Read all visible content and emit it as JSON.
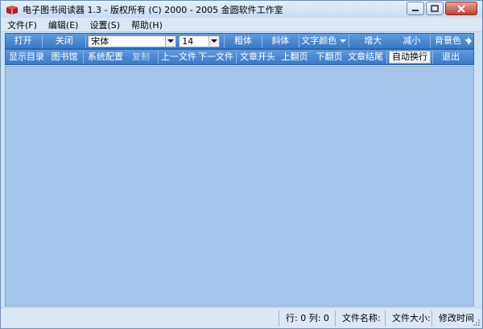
{
  "window": {
    "title": "电子图书阅读器 1.3  - 版权所有 (C) 2000 - 2005 金圆软件工作室"
  },
  "menu": [
    {
      "label": "文件(F)"
    },
    {
      "label": "编辑(E)"
    },
    {
      "label": "设置(S)"
    },
    {
      "label": "帮助(H)"
    }
  ],
  "toolbar1": {
    "open": "打开",
    "close": "关闭",
    "font_name": "宋体",
    "font_size": "14",
    "bold": "粗体",
    "italic": "斜体",
    "text_color": "文字颜色",
    "enlarge": "增大",
    "shrink": "减小",
    "bg_color": "背景色"
  },
  "toolbar2": {
    "show_toc": "显示目录",
    "library": "图书馆",
    "sys_config": "系统配置",
    "copy": "复制",
    "prev_file": "上一文件",
    "next_file": "下一文件",
    "doc_start": "文章开头",
    "page_up": "上翻页",
    "page_down": "下翻页",
    "doc_end": "文章结尾",
    "auto_wrap": "自动换行",
    "exit": "退出"
  },
  "statusbar": {
    "row_col": "行: 0  列: 0",
    "file_name": "文件名称:",
    "file_size": "文件大小:",
    "modified": "修改时间"
  },
  "colors": {
    "toolbar": "#3a78c6",
    "content": "#a4c4ea",
    "chrome": "#dbe7f5"
  },
  "icons": {
    "app": "book-icon",
    "minimize": "minimize-icon",
    "maximize": "maximize-icon",
    "close": "close-icon"
  }
}
